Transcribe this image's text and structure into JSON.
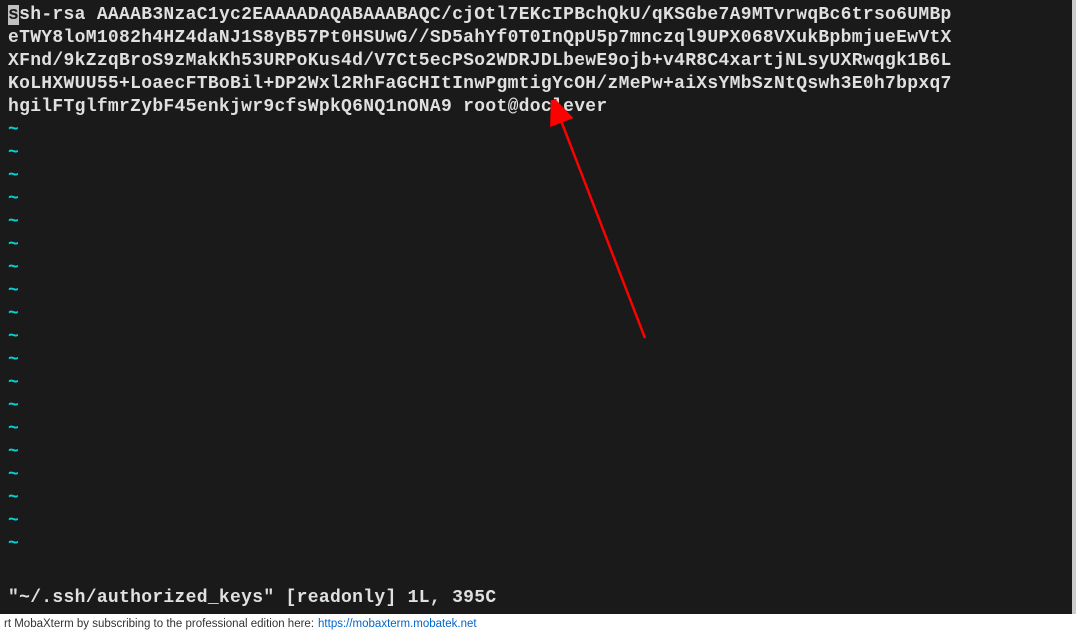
{
  "terminal": {
    "cursor_char": "s",
    "line1_rest": "sh-rsa AAAAB3NzaC1yc2EAAAADAQABAAABAQC/cjOtl7EKcIPBchQkU/qKSGbe7A9MTvrwqBc6trso6UMBp",
    "line2": "eTWY8loM1082h4HZ4daNJ1S8yB57Pt0HSUwG//SD5ahYf0T0InQpU5p7mnczql9UPX068VXukBpbmjueEwVtX",
    "line3": "XFnd/9kZzqBroS9zMakKh53URPoKus4d/V7Ct5ecPSo2WDRJDLbewE9ojb+v4R8C4xartjNLsyUXRwqgk1B6L",
    "line4": "KoLHXWUU55+LoaecFTBoBil+DP2Wxl2RhFaGCHItInwPgmtigYcOH/zMePw+aiXsYMbSzNtQswh3E0h7bpxq7",
    "line5": "hgilFTglfmrZybF45enkjwr9cfsWpkQ6NQ1nONA9 root@doclever",
    "tilde": "~",
    "status": "\"~/.ssh/authorized_keys\" [readonly] 1L, 395C"
  },
  "footer": {
    "text": "rt MobaXterm by subscribing to the professional edition here:",
    "link": "https://mobaxterm.mobatek.net"
  }
}
